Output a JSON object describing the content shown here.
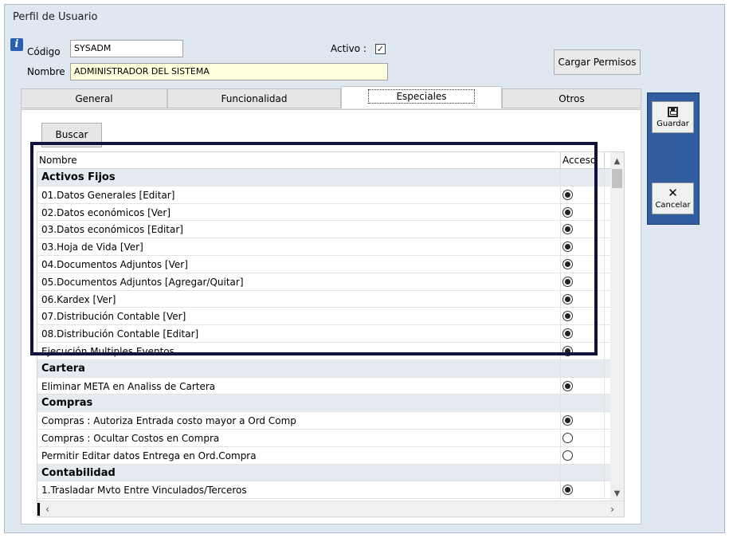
{
  "window": {
    "title": "Perfil de Usuario"
  },
  "form": {
    "codigo_label": "Código",
    "codigo_value": "SYSADM",
    "nombre_label": "Nombre",
    "nombre_value": "ADMINISTRADOR DEL SISTEMA",
    "activo_label": "Activo :",
    "activo_checked": true,
    "cargar_permisos_label": "Cargar Permisos"
  },
  "tabs": [
    {
      "label": "General",
      "active": false
    },
    {
      "label": "Funcionalidad",
      "active": false
    },
    {
      "label": "Especiales",
      "active": true
    },
    {
      "label": "Otros",
      "active": false
    }
  ],
  "buscar_label": "Buscar",
  "grid": {
    "columns": {
      "name": "Nombre",
      "access": "Acceso"
    },
    "rows": [
      {
        "type": "group",
        "name": "Activos Fijos"
      },
      {
        "type": "item",
        "name": "01.Datos Generales [Editar]",
        "access": true
      },
      {
        "type": "item",
        "name": "02.Datos económicos [Ver]",
        "access": true
      },
      {
        "type": "item",
        "name": "03.Datos económicos [Editar]",
        "access": true
      },
      {
        "type": "item",
        "name": "03.Hoja de Vida [Ver]",
        "access": true
      },
      {
        "type": "item",
        "name": "04.Documentos Adjuntos [Ver]",
        "access": true
      },
      {
        "type": "item",
        "name": "05.Documentos Adjuntos [Agregar/Quitar]",
        "access": true
      },
      {
        "type": "item",
        "name": "06.Kardex [Ver]",
        "access": true
      },
      {
        "type": "item",
        "name": "07.Distribución Contable [Ver]",
        "access": true
      },
      {
        "type": "item",
        "name": "08.Distribución Contable [Editar]",
        "access": true
      },
      {
        "type": "item",
        "name": "Ejecución Multiples Eventos",
        "access": true
      },
      {
        "type": "group",
        "name": "Cartera"
      },
      {
        "type": "item",
        "name": "Eliminar META en Analiss de Cartera",
        "access": true
      },
      {
        "type": "group",
        "name": "Compras"
      },
      {
        "type": "item",
        "name": "Compras : Autoriza Entrada costo mayor a Ord Comp",
        "access": true
      },
      {
        "type": "item",
        "name": "Compras : Ocultar Costos en Compra",
        "access": false
      },
      {
        "type": "item",
        "name": "Permitir Editar datos Entrega en Ord.Compra",
        "access": false
      },
      {
        "type": "group",
        "name": "Contabilidad"
      },
      {
        "type": "item",
        "name": "1.Trasladar Mvto Entre Vinculados/Terceros",
        "access": true
      }
    ]
  },
  "side": {
    "guardar_label": "Guardar",
    "cancelar_label": "Cancelar"
  },
  "icons": {
    "info": "info-icon",
    "save": "floppy-disk-icon",
    "cancel": "x-cross-icon"
  }
}
